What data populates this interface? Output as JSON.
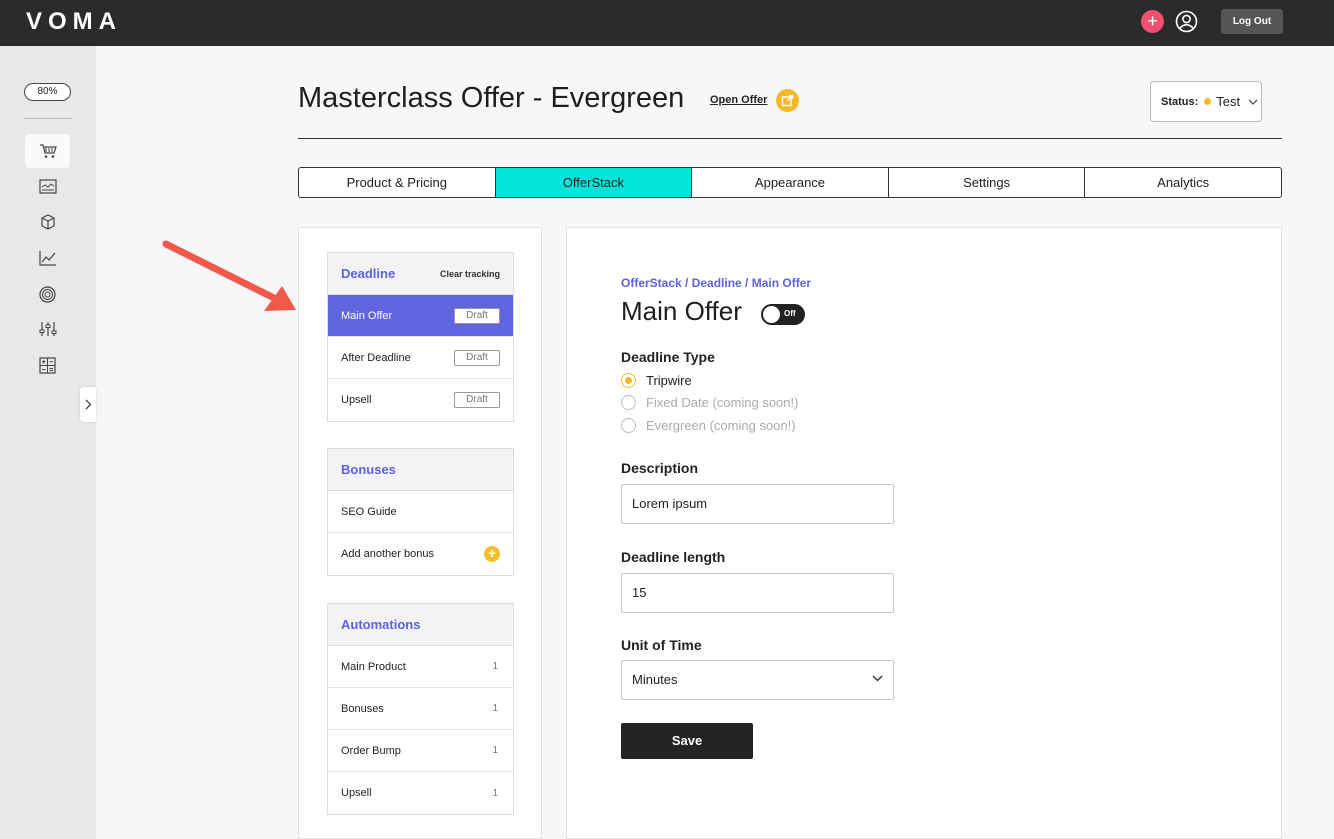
{
  "app": {
    "logo_text": "VOMA",
    "logout_label": "Log Out",
    "zoom": "80%"
  },
  "sidebar": {
    "icons": [
      "cart-icon",
      "dashboard-icon",
      "box-icon",
      "chart-line-icon",
      "target-icon",
      "sliders-icon",
      "calculator-icon"
    ],
    "active_index": 0
  },
  "header": {
    "title": "Masterclass Offer - Evergreen",
    "open_offer_label": "Open Offer",
    "status_label": "Status:",
    "status_value": "Test",
    "status_color": "#f5b82a"
  },
  "tabs": [
    {
      "label": "Product & Pricing",
      "active": false
    },
    {
      "label": "OfferStack",
      "active": true
    },
    {
      "label": "Appearance",
      "active": false
    },
    {
      "label": "Settings",
      "active": false
    },
    {
      "label": "Analytics",
      "active": false
    }
  ],
  "deadline_card": {
    "title": "Deadline",
    "clear_label": "Clear tracking",
    "items": [
      {
        "label": "Main Offer",
        "badge": "Draft",
        "selected": true
      },
      {
        "label": "After Deadline",
        "badge": "Draft",
        "selected": false
      },
      {
        "label": "Upsell",
        "badge": "Draft",
        "selected": false
      }
    ]
  },
  "bonuses_card": {
    "title": "Bonuses",
    "items": [
      {
        "label": "SEO Guide"
      }
    ],
    "add_label": "Add another bonus"
  },
  "automations_card": {
    "title": "Automations",
    "items": [
      {
        "label": "Main Product",
        "count": "1"
      },
      {
        "label": "Bonuses",
        "count": "1"
      },
      {
        "label": "Order Bump",
        "count": "1"
      },
      {
        "label": "Upsell",
        "count": "1"
      }
    ]
  },
  "form": {
    "breadcrumb": "OfferStack / Deadline / Main Offer",
    "title": "Main Offer",
    "toggle_label": "Off",
    "deadline_type_label": "Deadline Type",
    "deadline_types": [
      {
        "label": "Tripwire",
        "selected": true,
        "disabled": false
      },
      {
        "label": "Fixed Date (coming soon!)",
        "selected": false,
        "disabled": true
      },
      {
        "label": "Evergreen (coming soon!)",
        "selected": false,
        "disabled": true
      }
    ],
    "description_label": "Description",
    "description_value": "Lorem ipsum",
    "deadline_length_label": "Deadline length",
    "deadline_length_value": "15",
    "unit_label": "Unit of Time",
    "unit_value": "Minutes",
    "save_label": "Save"
  },
  "colors": {
    "accent": "#00e5d8",
    "selected": "#6166e0",
    "link": "#5c63d8",
    "annotation_arrow": "#f0584a"
  }
}
